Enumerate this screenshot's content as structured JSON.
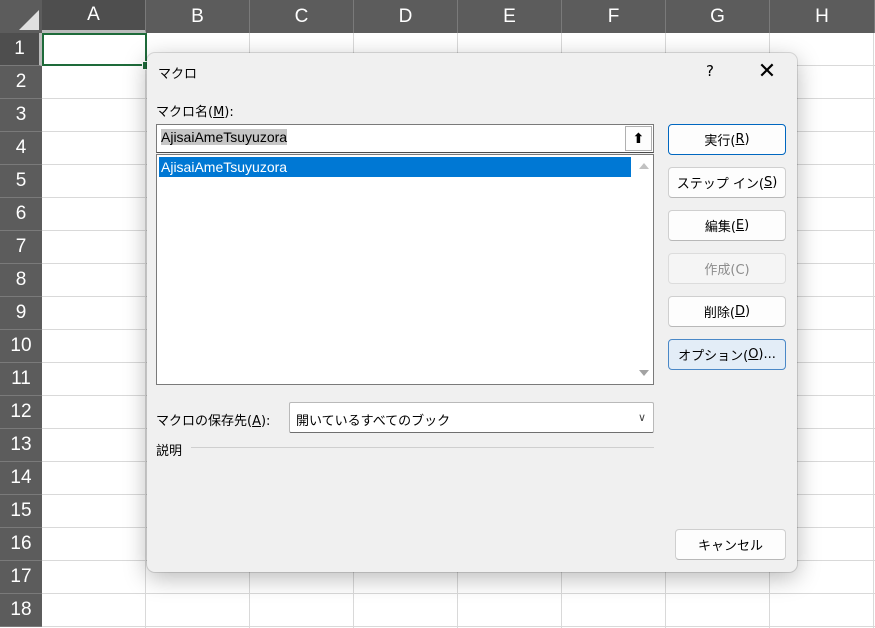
{
  "sheet": {
    "columns": [
      "A",
      "B",
      "C",
      "D",
      "E",
      "F",
      "G",
      "H"
    ],
    "rows": [
      "1",
      "2",
      "3",
      "4",
      "5",
      "6",
      "7",
      "8",
      "9",
      "10",
      "11",
      "12",
      "13",
      "14",
      "15",
      "16",
      "17",
      "18"
    ],
    "selected_column": "A",
    "selected_row": "1"
  },
  "dialog": {
    "title": "マクロ",
    "help_label": "?",
    "close_label": "✕",
    "macro_name_label_prefix": "マクロ名(",
    "macro_name_label_key": "M",
    "macro_name_label_suffix": "):",
    "macro_name_value": "AjisaiAmeTsuyuzora",
    "ref_button_label": "⬆",
    "macro_list": [
      "AjisaiAmeTsuyuzora"
    ],
    "buttons": {
      "run": {
        "text": "実行(",
        "key": "R",
        "end": ")"
      },
      "step_in": {
        "text": "ステップ イン(",
        "key": "S",
        "end": ")"
      },
      "edit": {
        "text": "編集(",
        "key": "E",
        "end": ")"
      },
      "create": {
        "text": "作成(C)"
      },
      "delete": {
        "text": "削除(",
        "key": "D",
        "end": ")"
      },
      "options": {
        "text": "オプション(",
        "key": "O",
        "end": ")..."
      },
      "cancel": {
        "text": "キャンセル"
      }
    },
    "location_label_prefix": "マクロの保存先(",
    "location_label_key": "A",
    "location_label_suffix": "):",
    "location_value": "開いているすべてのブック",
    "description_label": "説明"
  },
  "colors": {
    "header_bg": "#5c5c5c",
    "accent": "#0078d4",
    "cell_border": "#1e6b3a"
  }
}
